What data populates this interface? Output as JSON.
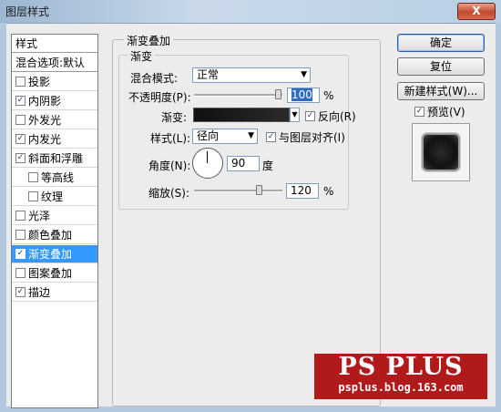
{
  "window": {
    "title": "图层样式",
    "close_glyph": "X"
  },
  "sidebar": {
    "header": "样式",
    "blend_header": "混合选项:默认",
    "items": [
      {
        "label": "投影",
        "checked": false
      },
      {
        "label": "内阴影",
        "checked": true
      },
      {
        "label": "外发光",
        "checked": false
      },
      {
        "label": "内发光",
        "checked": true
      },
      {
        "label": "斜面和浮雕",
        "checked": true
      },
      {
        "label": "等高线",
        "checked": false
      },
      {
        "label": "纹理",
        "checked": false
      },
      {
        "label": "光泽",
        "checked": false
      },
      {
        "label": "颜色叠加",
        "checked": false
      },
      {
        "label": "渐变叠加",
        "checked": true,
        "selected": true
      },
      {
        "label": "图案叠加",
        "checked": false
      },
      {
        "label": "描边",
        "checked": true
      }
    ]
  },
  "main": {
    "group_title": "渐变叠加",
    "sub_title": "渐变",
    "blend_mode_label": "混合模式:",
    "blend_mode_value": "正常",
    "opacity_label": "不透明度(P):",
    "opacity_value": "100",
    "opacity_level": 1.0,
    "percent": "%",
    "gradient_label": "渐变:",
    "reverse_label": "反向(R)",
    "reverse_checked": true,
    "style_label": "样式(L):",
    "style_value": "径向",
    "align_label": "与图层对齐(I)",
    "align_checked": true,
    "angle_label": "角度(N):",
    "angle_value": "90",
    "angle_unit": "度",
    "scale_label": "缩放(S):",
    "scale_value": "120",
    "scale_level": 0.6
  },
  "buttons": {
    "ok": "确定",
    "reset": "复位",
    "new_style": "新建样式(W)...",
    "preview_label": "预览(V)",
    "preview_checked": true
  },
  "watermark": {
    "logo_text": "PS PLUS",
    "url": "psplus.blog.163.com"
  },
  "colors": {
    "selection": "#3399ff",
    "watermark_red": "#b01a1a"
  }
}
